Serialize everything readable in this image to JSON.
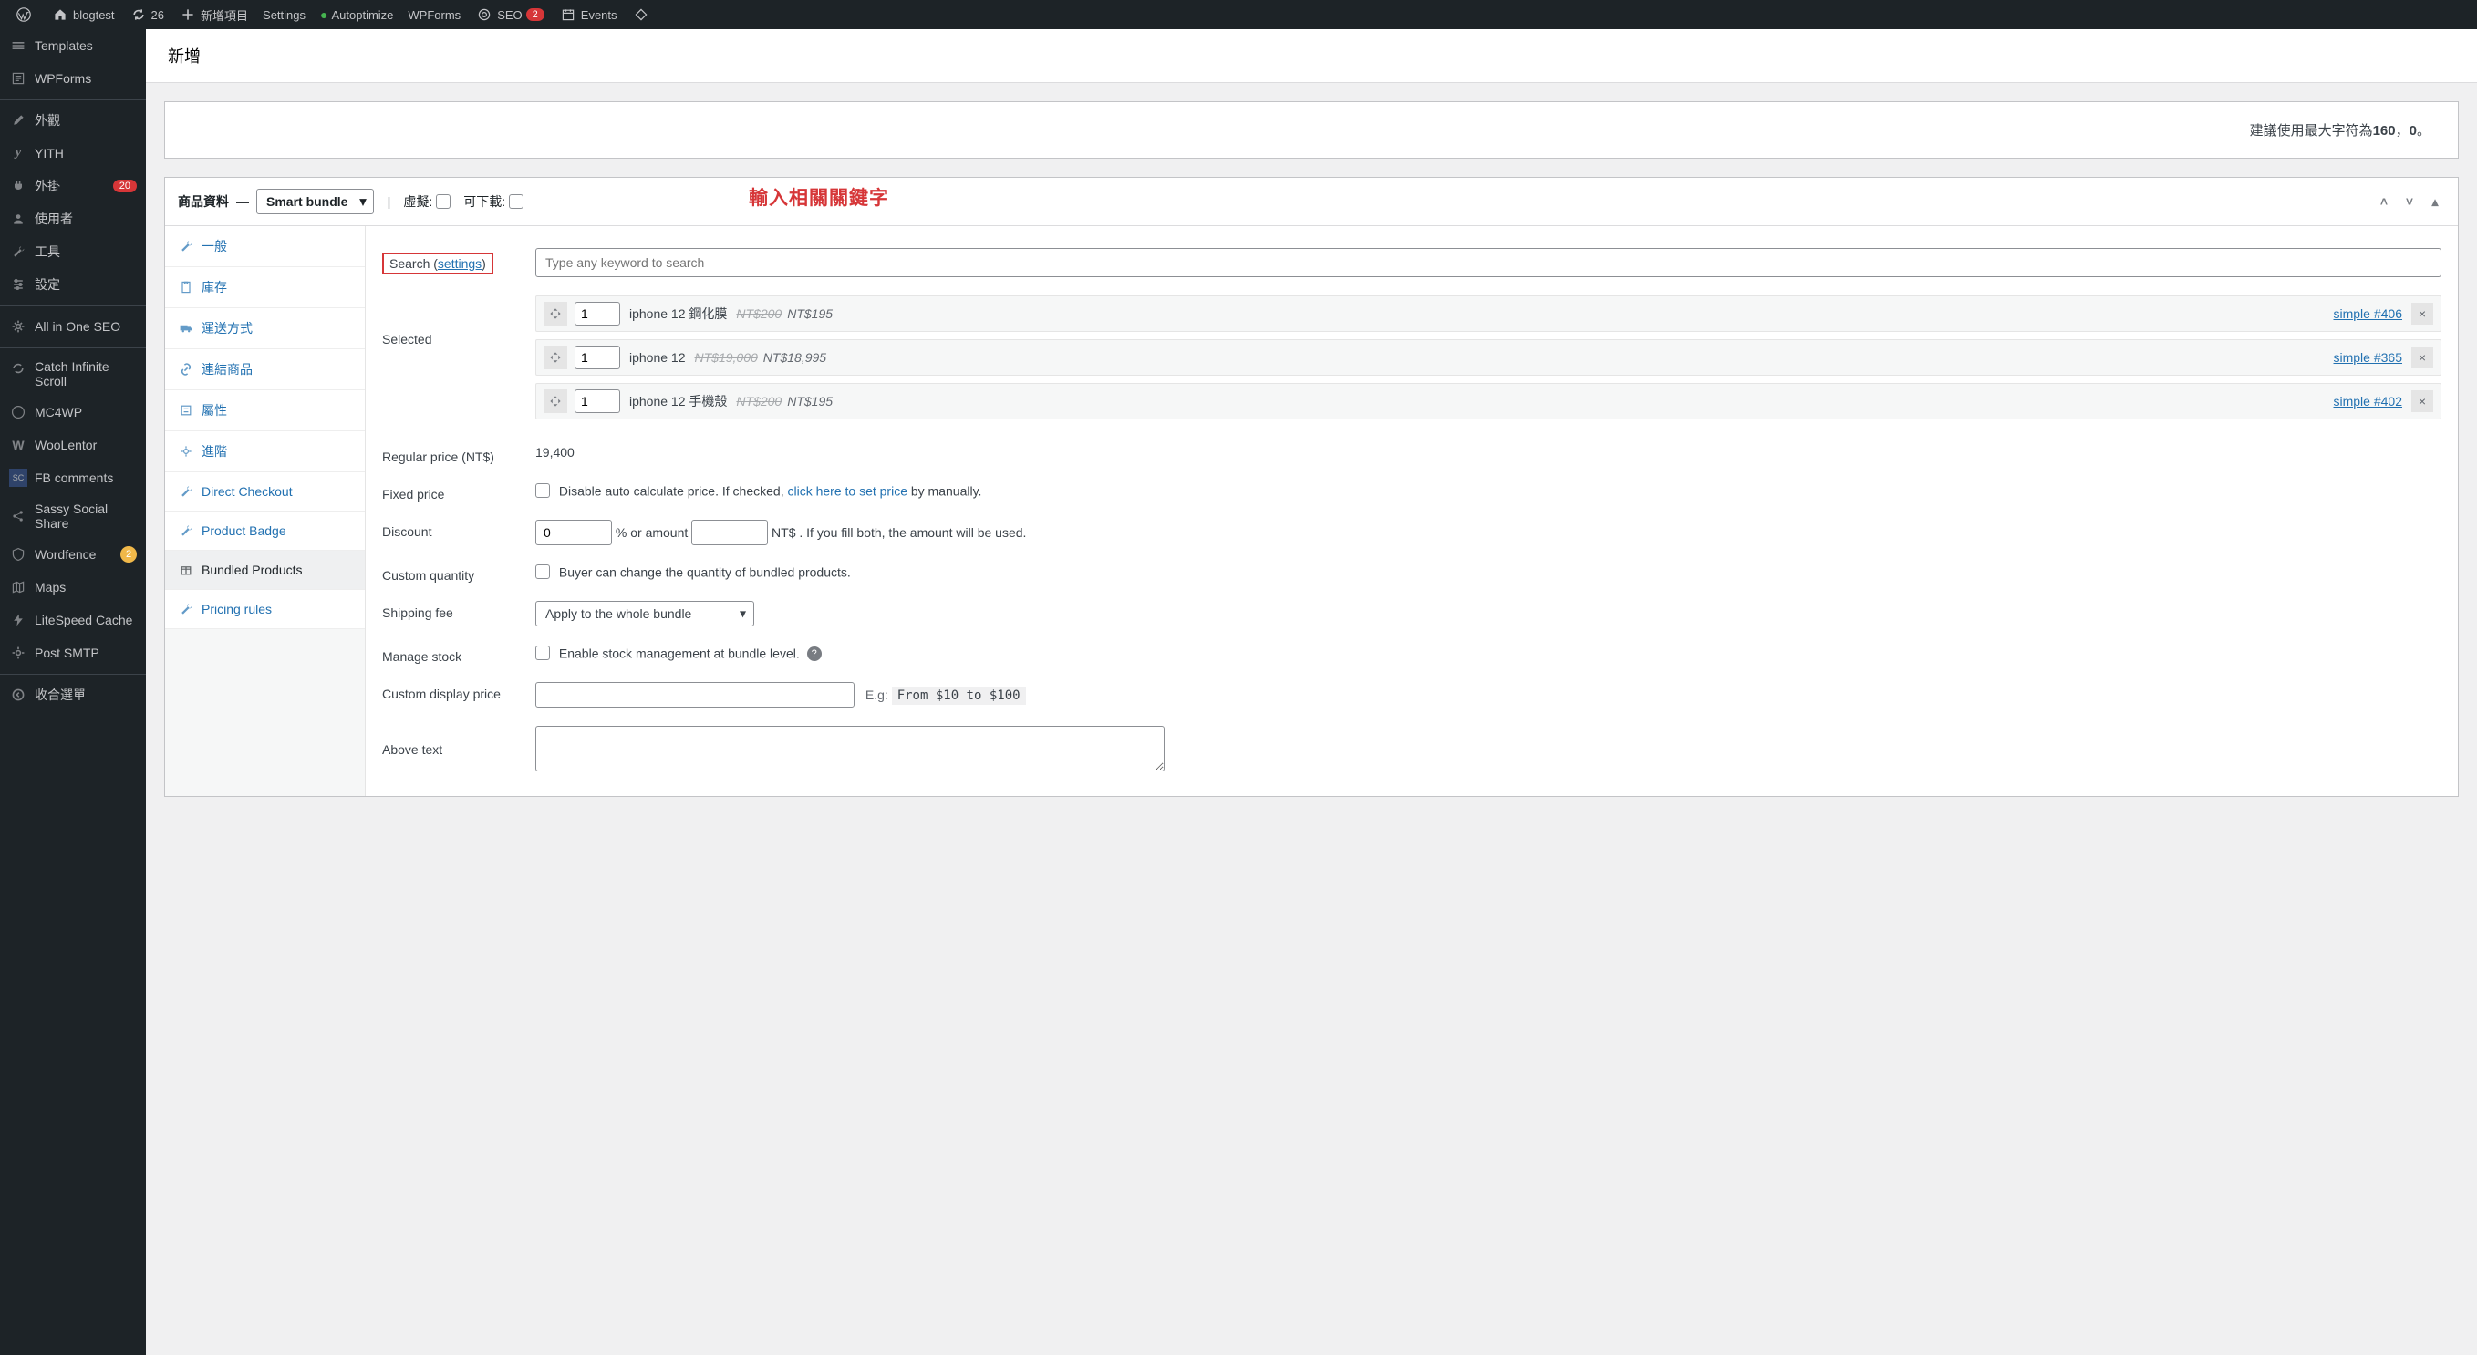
{
  "admin_bar": {
    "site": "blogtest",
    "updates": "26",
    "new_item": "新增項目",
    "settings": "Settings",
    "autoptimize": "Autoptimize",
    "wpforms": "WPForms",
    "seo": "SEO",
    "seo_badge": "2",
    "events": "Events"
  },
  "sidebar": {
    "items": [
      {
        "label": "Templates"
      },
      {
        "label": "WPForms"
      },
      {
        "label": "外觀"
      },
      {
        "label": "YITH"
      },
      {
        "label": "外掛",
        "badge": "20"
      },
      {
        "label": "使用者"
      },
      {
        "label": "工具"
      },
      {
        "label": "設定"
      },
      {
        "label": "All in One SEO"
      },
      {
        "label": "Catch Infinite Scroll"
      },
      {
        "label": "MC4WP"
      },
      {
        "label": "WooLentor"
      },
      {
        "label": "FB comments"
      },
      {
        "label": "Sassy Social Share"
      },
      {
        "label": "Wordfence",
        "badge_o": "2"
      },
      {
        "label": "Maps"
      },
      {
        "label": "LiteSpeed Cache"
      },
      {
        "label": "Post SMTP"
      },
      {
        "label": "收合選單"
      }
    ]
  },
  "page": {
    "title": "新增"
  },
  "hint": {
    "prefix": "建議使用最大字符為",
    "a": "160",
    "mid": "，",
    "b": "0",
    "suffix": "。"
  },
  "product_panel": {
    "header_label": "商品資料",
    "type": "Smart bundle",
    "virtual_label": "虛擬:",
    "downloadable_label": "可下載:",
    "overlay": "輸入相關關鍵字"
  },
  "tabs": [
    {
      "label": "一般"
    },
    {
      "label": "庫存"
    },
    {
      "label": "運送方式"
    },
    {
      "label": "連結商品"
    },
    {
      "label": "屬性"
    },
    {
      "label": "進階"
    },
    {
      "label": "Direct Checkout"
    },
    {
      "label": "Product Badge"
    },
    {
      "label": "Bundled Products",
      "active": true
    },
    {
      "label": "Pricing rules"
    }
  ],
  "fields": {
    "search": {
      "label": "Search (",
      "link": "settings",
      "close": ")",
      "placeholder": "Type any keyword to search"
    },
    "selected": {
      "label": "Selected",
      "items": [
        {
          "qty": "1",
          "name": "iphone 12 鋼化膜",
          "old": "NT$200",
          "new": "NT$195",
          "link": "simple #406"
        },
        {
          "qty": "1",
          "name": "iphone 12",
          "old": "NT$19,000",
          "new": "NT$18,995",
          "link": "simple #365"
        },
        {
          "qty": "1",
          "name": "iphone 12 手機殼",
          "old": "NT$200",
          "new": "NT$195",
          "link": "simple #402"
        }
      ]
    },
    "regular_price": {
      "label": "Regular price (NT$)",
      "value": "19,400"
    },
    "fixed_price": {
      "label": "Fixed price",
      "text": "Disable auto calculate price.",
      "mid": "If checked, ",
      "link": "click here to set price",
      "tail": " by manually."
    },
    "discount": {
      "label": "Discount",
      "percent": "0",
      "mid": "% or amount",
      "amount": "",
      "tail": "NT$ . If you fill both, the amount will be used."
    },
    "custom_qty": {
      "label": "Custom quantity",
      "text": "Buyer can change the quantity of bundled products."
    },
    "shipping": {
      "label": "Shipping fee",
      "value": "Apply to the whole bundle"
    },
    "manage_stock": {
      "label": "Manage stock",
      "text": "Enable stock management at bundle level."
    },
    "custom_display": {
      "label": "Custom display price",
      "eg": "E.g:",
      "code": "From $10 to $100"
    },
    "above_text": {
      "label": "Above text"
    }
  }
}
